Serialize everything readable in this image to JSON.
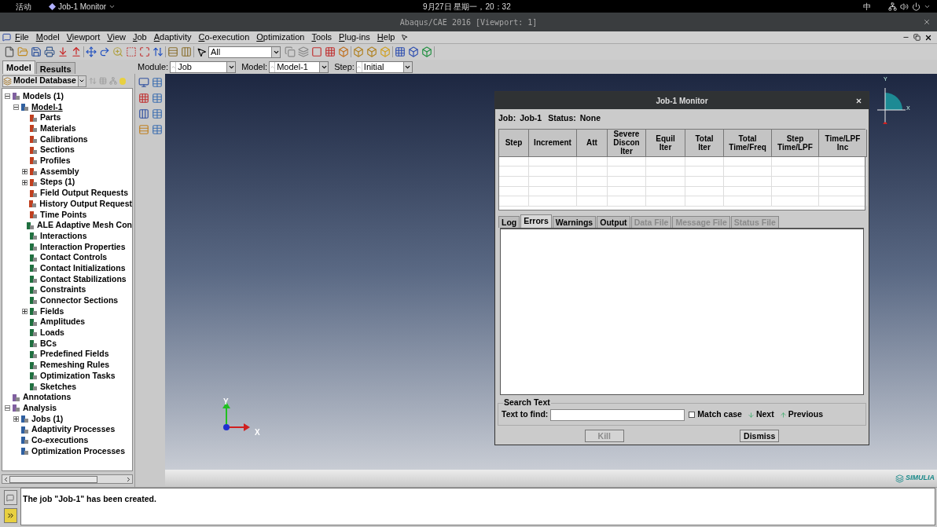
{
  "topbar": {
    "activities": "活动",
    "app_menu": "Job-1 Monitor",
    "clock": "9月27日 星期一，20：32",
    "input_method": "中"
  },
  "window": {
    "title": "Abaqus/CAE 2016 [Viewport: 1]"
  },
  "menu": [
    "File",
    "Model",
    "Viewport",
    "View",
    "Job",
    "Adaptivity",
    "Co-execution",
    "Optimization",
    "Tools",
    "Plug-ins",
    "Help"
  ],
  "toolbar": {
    "selection_filter": "All"
  },
  "panel_tabs": [
    {
      "label": "Model",
      "selected": true
    },
    {
      "label": "Results",
      "selected": false
    }
  ],
  "context": [
    {
      "label": "Module:",
      "value": "Job"
    },
    {
      "label": "Model:",
      "value": "Model-1"
    },
    {
      "label": "Step:",
      "value": "Initial"
    }
  ],
  "tree_source": "Model Database",
  "tree": [
    {
      "label": "Models (1)",
      "selected": false,
      "expanded": true,
      "children": [
        {
          "label": "Model-1",
          "selected": true,
          "expanded": true,
          "children": [
            {
              "label": "Parts",
              "selected": false
            },
            {
              "label": "Materials",
              "selected": false
            },
            {
              "label": "Calibrations",
              "selected": false
            },
            {
              "label": "Sections",
              "selected": false
            },
            {
              "label": "Profiles",
              "selected": false
            },
            {
              "label": "Assembly",
              "selected": false,
              "expanded": false
            },
            {
              "label": "Steps (1)",
              "selected": false,
              "expanded": false
            },
            {
              "label": "Field Output Requests",
              "selected": false
            },
            {
              "label": "History Output Request",
              "selected": false
            },
            {
              "label": "Time Points",
              "selected": false
            },
            {
              "label": "ALE Adaptive Mesh Con",
              "selected": false
            },
            {
              "label": "Interactions",
              "selected": false
            },
            {
              "label": "Interaction Properties",
              "selected": false
            },
            {
              "label": "Contact Controls",
              "selected": false
            },
            {
              "label": "Contact Initializations",
              "selected": false
            },
            {
              "label": "Contact Stabilizations",
              "selected": false
            },
            {
              "label": "Constraints",
              "selected": false
            },
            {
              "label": "Connector Sections",
              "selected": false
            },
            {
              "label": "Fields",
              "selected": false,
              "expanded": false
            },
            {
              "label": "Amplitudes",
              "selected": false
            },
            {
              "label": "Loads",
              "selected": false
            },
            {
              "label": "BCs",
              "selected": false
            },
            {
              "label": "Predefined Fields",
              "selected": false
            },
            {
              "label": "Remeshing Rules",
              "selected": false
            },
            {
              "label": "Optimization Tasks",
              "selected": false
            },
            {
              "label": "Sketches",
              "selected": false
            }
          ]
        }
      ]
    },
    {
      "label": "Annotations",
      "selected": false
    },
    {
      "label": "Analysis",
      "selected": false,
      "expanded": true,
      "children": [
        {
          "label": "Jobs (1)",
          "selected": false,
          "expanded": false
        },
        {
          "label": "Adaptivity Processes",
          "selected": false
        },
        {
          "label": "Co-executions",
          "selected": false
        },
        {
          "label": "Optimization Processes",
          "selected": false
        }
      ]
    }
  ],
  "viewport": {
    "axis_labels": [
      "Y",
      "X"
    ],
    "view_triad_labels": [
      "Y",
      "X"
    ]
  },
  "monitor": {
    "title": "Job-1 Monitor",
    "job_label": "Job:",
    "job": "Job-1",
    "status_label": "Status:",
    "status": "None",
    "columns": [
      "Step",
      "Increment",
      "Att",
      "Severe Discon Iter",
      "Equil Iter",
      "Total Iter",
      "Total Time/Freq",
      "Step Time/LPF",
      "Time/LPF Inc"
    ],
    "tabs": [
      {
        "label": "Log",
        "selected": false,
        "disabled": false
      },
      {
        "label": "Errors",
        "selected": true,
        "disabled": false
      },
      {
        "label": "Warnings",
        "selected": false,
        "disabled": false
      },
      {
        "label": "Output",
        "selected": false,
        "disabled": false
      },
      {
        "label": "Data File",
        "selected": false,
        "disabled": true
      },
      {
        "label": "Message File",
        "selected": false,
        "disabled": true
      },
      {
        "label": "Status File",
        "selected": false,
        "disabled": true
      }
    ],
    "search": {
      "legend": "Search Text",
      "label": "Text to find:",
      "match_case": {
        "label": "Match case",
        "checked": false
      },
      "next": "Next",
      "previous": "Previous"
    },
    "buttons": [
      {
        "label": "Kill",
        "disabled": true
      },
      {
        "label": "Dismiss",
        "disabled": false
      }
    ]
  },
  "brand": "SIMULIA",
  "message": "The job \"Job-1\" has been created."
}
